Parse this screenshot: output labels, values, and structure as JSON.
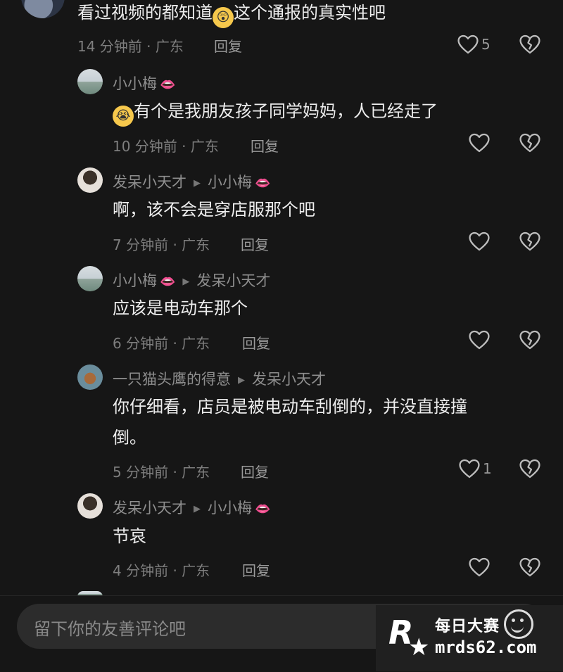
{
  "top_comment": {
    "text_before": "看过视频的都知道",
    "emoji": "😲",
    "text_after": "这个通报的真实性吧",
    "meta": "14 分钟前 · 广东",
    "reply_label": "回复",
    "like_count": "5"
  },
  "replies": [
    {
      "user": "小小梅",
      "user_badge": "👄",
      "reply_to": "",
      "reply_to_badge": "",
      "emoji": "😭",
      "text": "有个是我朋友孩子同学妈妈，人已经走了",
      "meta": "10 分钟前 · 广东",
      "reply_label": "回复",
      "like_count": ""
    },
    {
      "user": "发呆小天才",
      "user_badge": "",
      "reply_to": "小小梅",
      "reply_to_badge": "👄",
      "emoji": "",
      "text": "啊，该不会是穿店服那个吧",
      "meta": "7 分钟前 · 广东",
      "reply_label": "回复",
      "like_count": ""
    },
    {
      "user": "小小梅",
      "user_badge": "👄",
      "reply_to": "发呆小天才",
      "reply_to_badge": "",
      "emoji": "",
      "text": "应该是电动车那个",
      "meta": "6 分钟前 · 广东",
      "reply_label": "回复",
      "like_count": ""
    },
    {
      "user": "一只猫头鹰的得意",
      "user_badge": "",
      "reply_to": "发呆小天才",
      "reply_to_badge": "",
      "emoji": "",
      "text_line1": "你仔细看，店员是被电动车刮倒的，并没直接撞",
      "text_line2": "倒。",
      "meta": "5 分钟前 · 广东",
      "reply_label": "回复",
      "like_count": "1"
    },
    {
      "user": "发呆小天才",
      "user_badge": "",
      "reply_to": "小小梅",
      "reply_to_badge": "👄",
      "emoji": "",
      "text": "节哀",
      "meta": "4 分钟前 · 广东",
      "reply_label": "回复",
      "like_count": ""
    }
  ],
  "composer": {
    "placeholder": "留下你的友善评论吧"
  },
  "watermark": {
    "logo_letter": "R",
    "cn_text": "每日大赛",
    "url": "mrds62.com"
  },
  "icons": {
    "like": "heart-outline-icon",
    "dislike": "broken-heart-icon",
    "emoji_picker": "smiley-icon"
  }
}
